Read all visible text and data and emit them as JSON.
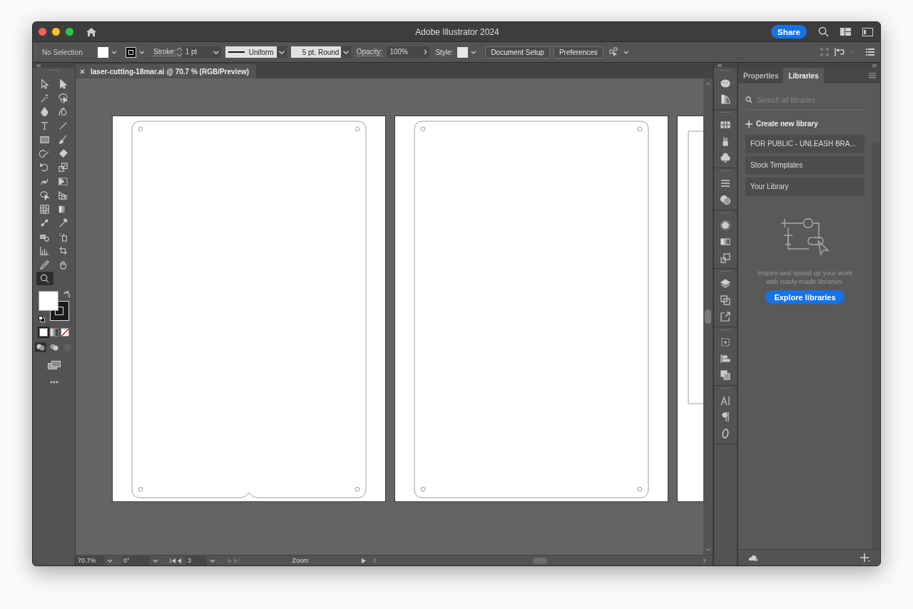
{
  "window": {
    "title": "Adobe Illustrator 2024"
  },
  "title_bar": {
    "share_button": "Share"
  },
  "control_bar": {
    "selection": "No Selection",
    "stroke_label": "Stroke:",
    "stroke_weight": "1 pt",
    "stroke_profile": "Uniform",
    "brush": "5 pt. Round",
    "opacity_label": "Opacity:",
    "opacity": "100%",
    "style_label": "Style:",
    "buttons": [
      "Document Setup",
      "Preferences"
    ]
  },
  "document_tab": {
    "title": "laser-cutting-18mar.ai @ 70.7 % (RGB/Preview)"
  },
  "tools": [
    {
      "selected": false
    },
    {
      "selected": false
    },
    {
      "selected": false
    },
    {
      "selected": false
    },
    {
      "selected": false
    },
    {
      "selected": false
    },
    {
      "selected": false
    },
    {
      "selected": false
    },
    {
      "selected": false
    },
    {
      "selected": false
    },
    {
      "selected": false
    },
    {
      "selected": false
    },
    {
      "selected": false
    },
    {
      "selected": false
    },
    {
      "selected": false
    },
    {
      "selected": false
    },
    {
      "selected": false
    },
    {
      "selected": false
    },
    {
      "selected": false
    },
    {
      "selected": false
    },
    {
      "selected": false
    },
    {
      "selected": false
    },
    {
      "selected": false
    },
    {
      "selected": false
    },
    {
      "selected": false
    },
    {
      "selected": false
    },
    {
      "selected": false
    },
    {
      "selected": false
    },
    {
      "selected": true
    }
  ],
  "panel": {
    "tabs": [
      {
        "label": "Properties",
        "selected": false
      },
      {
        "label": "Libraries",
        "selected": true
      }
    ],
    "search": {
      "placeholder": "Search all libraries"
    },
    "create_label": "Create new library",
    "libraries": [
      "FOR PUBLIC - UNLEASH BRA...",
      "Stock Templates",
      "Your Library"
    ],
    "empty_message": "Inspire and speed up your work with ready-made libraries.",
    "explore_button": "Explore libraries"
  },
  "status_bar": {
    "zoom": "70.7%",
    "rotation": "0°",
    "artboard": "3",
    "tool": "Zoom"
  }
}
